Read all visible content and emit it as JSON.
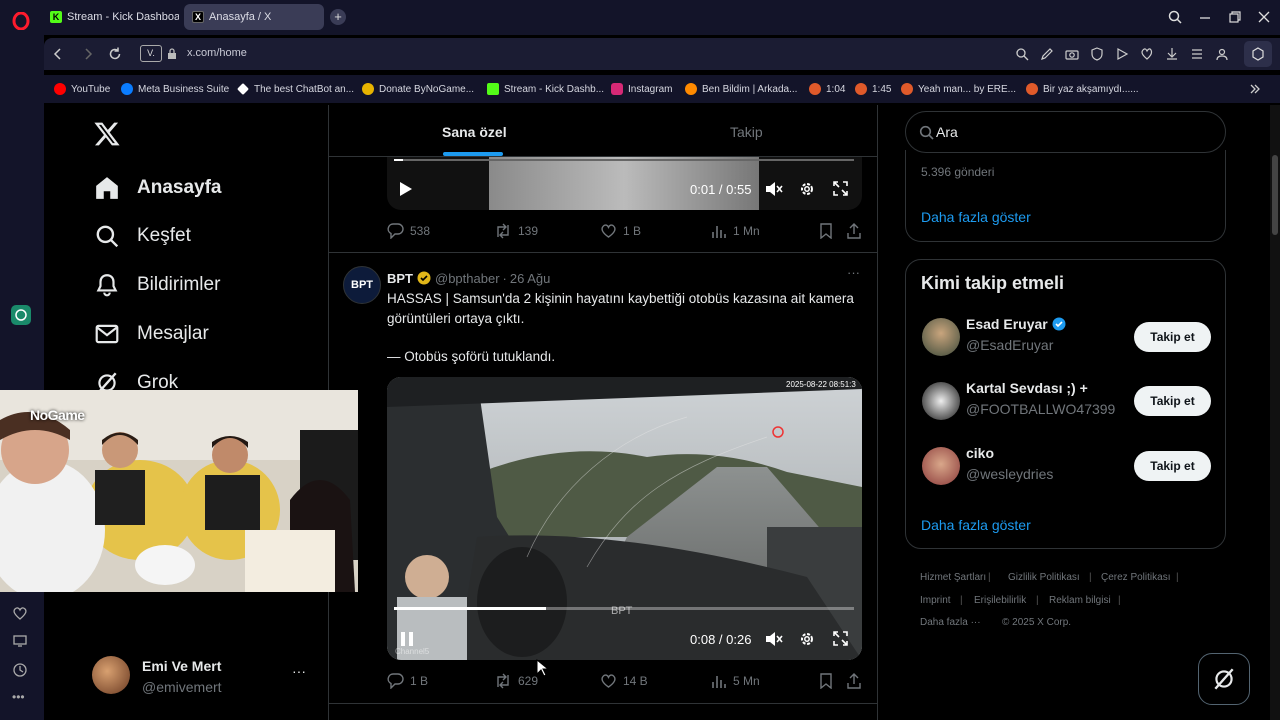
{
  "browser": {
    "tabs": [
      {
        "label": "Stream - Kick Dashboard",
        "icon": "kick-icon",
        "active": false
      },
      {
        "label": "Anasayfa / X",
        "icon": "x-icon",
        "active": true
      }
    ],
    "vpn_badge": "V.",
    "url": "x.com/home",
    "bookmarks": [
      {
        "label": "YouTube",
        "icon": "youtube-icon",
        "color": "#ff0000"
      },
      {
        "label": "Meta Business Suite",
        "icon": "meta-icon",
        "color": "#0a7cff"
      },
      {
        "label": "The best ChatBot an...",
        "icon": "chatbot-icon",
        "color": "#ffffff"
      },
      {
        "label": "Donate ByNoGame...",
        "icon": "bynogame-icon",
        "color": "#e8b400"
      },
      {
        "label": "Stream - Kick Dashb...",
        "icon": "kick-icon",
        "color": "#53fc18"
      },
      {
        "label": "Instagram",
        "icon": "instagram-icon",
        "color": "#d62976"
      },
      {
        "label": "Ben Bildim | Arkada...",
        "icon": "benbildim-icon",
        "color": "#ff8a00"
      },
      {
        "label": "1:04",
        "icon": "clip-icon",
        "color": "#e05a2a"
      },
      {
        "label": "1:45",
        "icon": "clip-icon",
        "color": "#e05a2a"
      },
      {
        "label": "Yeah man... by ERE...",
        "icon": "clip-icon",
        "color": "#e05a2a"
      },
      {
        "label": "Bir yaz akşamıydı......",
        "icon": "clip-icon",
        "color": "#e05a2a"
      }
    ]
  },
  "sidebar": {
    "items": [
      {
        "label": "Anasayfa",
        "icon": "home-icon",
        "bold": true
      },
      {
        "label": "Keşfet",
        "icon": "search-icon"
      },
      {
        "label": "Bildirimler",
        "icon": "bell-icon"
      },
      {
        "label": "Mesajlar",
        "icon": "mail-icon"
      },
      {
        "label": "Grok",
        "icon": "grok-icon"
      }
    ],
    "account": {
      "name": "Emi Ve Mert",
      "handle": "@emivemert"
    }
  },
  "feed": {
    "tabs": [
      "Sana özel",
      "Takip"
    ],
    "tweet1": {
      "video": {
        "time": "0:01 / 0:55",
        "progress": 0.02,
        "playing": false
      },
      "stats": {
        "replies": "538",
        "retweets": "139",
        "likes": "1 B",
        "views": "1 Mn"
      }
    },
    "tweet2": {
      "author": "BPT",
      "verified": true,
      "handle": "@bpthaber",
      "date": "26 Ağu",
      "avatar_text": "BPT",
      "text_line1": "HASSAS | Samsun'da 2 kişinin hayatını kaybettiği otobüs kazasına ait kamera",
      "text_line2": "görüntüleri ortaya çıktı.",
      "text_line3": "— Otobüs şoförü tutuklandı.",
      "video": {
        "time": "0:08 / 0:26",
        "progress": 0.33,
        "playing": true,
        "watermark": "BPT",
        "corner_label": "Channel5",
        "timestamp_overlay": "2025-08-22 08:51:3"
      },
      "stats": {
        "replies": "1 B",
        "retweets": "629",
        "likes": "14 B",
        "views": "5 Mn"
      }
    }
  },
  "right": {
    "search_placeholder": "Ara",
    "trend_posts": "5.396 gönderi",
    "show_more": "Daha fazla göster",
    "who_to_follow": {
      "title": "Kimi takip etmeli",
      "users": [
        {
          "name": "Esad Eruyar",
          "verified": true,
          "handle": "@EsadEruyar",
          "button": "Takip et"
        },
        {
          "name": "Kartal Sevdası ;) +",
          "verified": false,
          "handle": "@FOOTBALLWO47399",
          "button": "Takip et"
        },
        {
          "name": "ciko",
          "verified": false,
          "handle": "@wesleydries",
          "button": "Takip et"
        }
      ],
      "show_more": "Daha fazla göster"
    },
    "footer": [
      "Hizmet Şartları",
      "Gizlilik Politikası",
      "Çerez Politikası",
      "Imprint",
      "Erişilebilirlik",
      "Reklam bilgisi",
      "Daha fazla ···",
      "© 2025 X Corp."
    ]
  },
  "webcam": {
    "overlay_text": "NoGame"
  },
  "colors": {
    "accent": "#1d9bf0",
    "background": "#000000",
    "browser": "#131429",
    "verified": "#1d9bf0",
    "gold": "#e2b719"
  }
}
